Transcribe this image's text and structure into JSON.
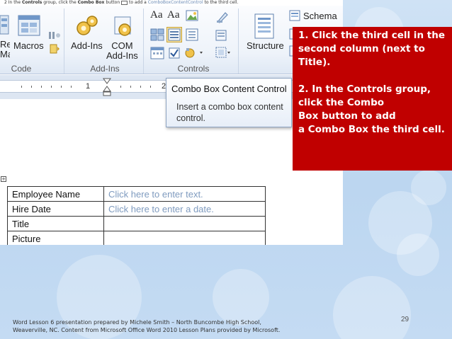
{
  "caption": {
    "prefix": "2 In the ",
    "controls_bold": "Controls",
    "middle": " group, click the ",
    "combo_bold": "Combo Box",
    "after": " button ",
    "suffix_pre": "to add a ",
    "combo_control": "ComboBoxContentControl",
    "suffix": " to the third cell."
  },
  "ribbon": {
    "macro_partial": "Rec\nMac",
    "macros_label": "Macros",
    "code_label": "Code",
    "addins_label": "Add-Ins",
    "com_addins_label": "COM\nAdd-Ins",
    "addins_group_label": "Add-Ins",
    "controls_group_label": "Controls",
    "structure_label": "Structure",
    "schema_label": "Schema",
    "aa1": "Aa",
    "aa2": "Aa"
  },
  "ruler": {
    "number": "1",
    "number2": "2"
  },
  "tooltip": {
    "title": "Combo Box Content Control",
    "body": "Insert a combo box content control."
  },
  "table": {
    "rows": [
      {
        "label": "Employee Name",
        "value": "Click here to enter text."
      },
      {
        "label": "Hire Date",
        "value": "Click here to enter a date."
      },
      {
        "label": "Title",
        "value": ""
      },
      {
        "label": "Picture",
        "value": ""
      }
    ]
  },
  "callout": {
    "step1": "1. Click the third cell in the second column (next to Title).",
    "step2a": "2. In the Controls group, click the Combo",
    "step2b": "Box button    to add",
    "step2c": "a Combo Box the third cell."
  },
  "page_number": "29",
  "footer": "Word Lesson 6 presentation prepared by Michele Smith – North Buncombe High School, Weaverville, NC. Content from Microsoft Office Word 2010 Lesson Plans provided by Microsoft.",
  "colors": {
    "callout_bg": "#c00000",
    "placeholder_text": "#7f9bbf"
  }
}
